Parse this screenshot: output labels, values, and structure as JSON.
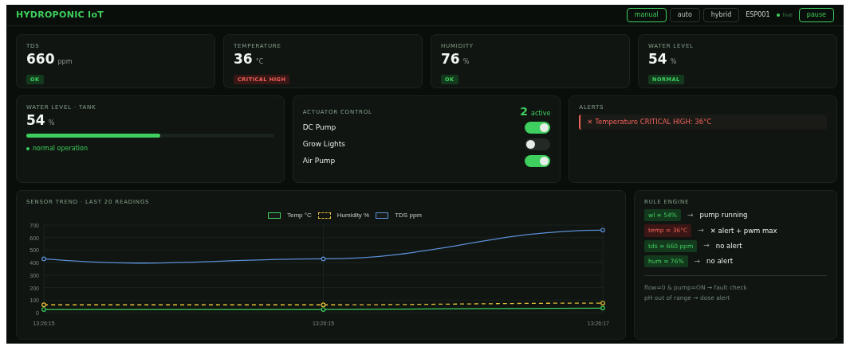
{
  "header": {
    "title": "HYDROPONIC IoT",
    "modes": [
      {
        "label": "manual",
        "selected": true
      },
      {
        "label": "auto",
        "selected": false
      },
      {
        "label": "hybrid",
        "selected": false
      }
    ],
    "device": "ESP001",
    "live": "live",
    "pause": "pause"
  },
  "stats": [
    {
      "label": "TDS",
      "value": "660",
      "unit": "ppm",
      "badge": "OK",
      "kind": "ok"
    },
    {
      "label": "TEMPERATURE",
      "value": "36",
      "unit": "°C",
      "badge": "CRITICAL HIGH",
      "kind": "critical"
    },
    {
      "label": "HUMIDITY",
      "value": "76",
      "unit": "%",
      "badge": "OK",
      "kind": "ok"
    },
    {
      "label": "WATER LEVEL",
      "value": "54",
      "unit": "%",
      "badge": "NORMAL",
      "kind": "ok"
    }
  ],
  "tank": {
    "label": "WATER LEVEL · TANK",
    "value": "54",
    "unit": "%",
    "level": 0.54,
    "note": "normal operation"
  },
  "actuators": {
    "title": "ACTUATOR CONTROL",
    "count": "2",
    "count_label": "active",
    "items": [
      {
        "name": "DC Pump",
        "on": true
      },
      {
        "name": "Grow Lights",
        "on": false
      },
      {
        "name": "Air Pump",
        "on": true
      }
    ]
  },
  "alerts": {
    "title": "ALERTS",
    "items": [
      "✕ Temperature CRITICAL HIGH: 36°C"
    ]
  },
  "trend": {
    "title": "SENSOR TREND · LAST 20 READINGS",
    "chart_data": {
      "type": "line",
      "categories": [
        "13:26:15",
        "13:26:15",
        "13:26:17"
      ],
      "ylim": [
        0,
        700
      ],
      "yticks": [
        0,
        100,
        200,
        300,
        400,
        500,
        600,
        700
      ],
      "grid": true,
      "series": [
        {
          "name": "Temp °C",
          "color": "#3ecf5e",
          "line_style": "solid",
          "marker": "circle",
          "values": [
            25,
            25,
            36
          ]
        },
        {
          "name": "Humidity %",
          "color": "#e8c23a",
          "line_style": "dashed",
          "marker": "circle",
          "values": [
            62,
            62,
            76
          ]
        },
        {
          "name": "TDS ppm",
          "color": "#5b8fd6",
          "line_style": "solid",
          "marker": "circle",
          "values": [
            430,
            430,
            660
          ]
        }
      ]
    }
  },
  "rules": {
    "title": "RULE ENGINE",
    "items": [
      {
        "condition": "wl = 54%",
        "kind": "ok",
        "arrow": "→",
        "result": "pump running"
      },
      {
        "condition": "temp = 36°C",
        "kind": "critical",
        "arrow": "→",
        "result": "✕ alert + pwm max"
      },
      {
        "condition": "tds = 660 ppm",
        "kind": "ok",
        "arrow": "→",
        "result": "no alert"
      },
      {
        "condition": "hum = 76%",
        "kind": "ok",
        "arrow": "→",
        "result": "no alert"
      }
    ],
    "notes": [
      "flow=0 & pump=ON → fault check",
      "pH out of range → dose alert"
    ]
  }
}
